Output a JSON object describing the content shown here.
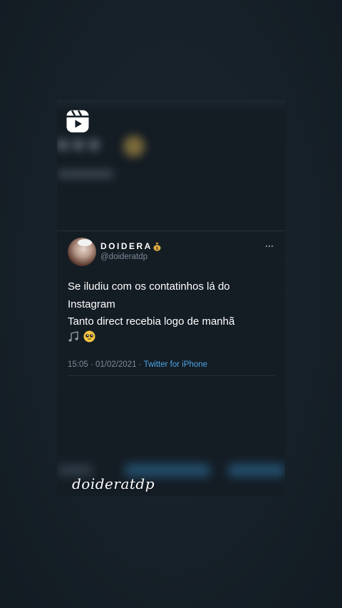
{
  "tweet": {
    "display_name": "DOIDERA",
    "name_emoji": "money-bag-icon",
    "handle": "@doideratdp",
    "text_lines": [
      "Se iludiu com os contatinhos lá do",
      "Instagram",
      "Tanto direct recebia logo de manhã"
    ],
    "trailing_emojis": [
      "musical-notes-icon",
      "pleading-face-icon"
    ],
    "timestamp": "15:05 · 01/02/2021 ·",
    "source": "Twitter for iPhone"
  },
  "watermark": "doideratdp",
  "colors": {
    "background": "#18232b",
    "card": "#141c24",
    "handle": "#7d8a96",
    "link": "#4ea6e8"
  }
}
